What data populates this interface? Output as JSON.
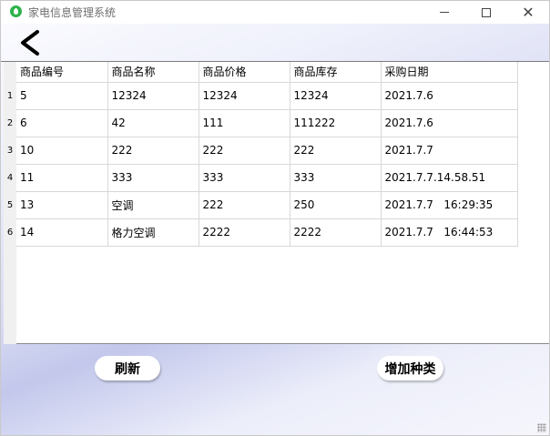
{
  "window": {
    "title": "家电信息管理系统",
    "controls": {
      "minimize": "—",
      "maximize": "☐",
      "close": "✕"
    }
  },
  "toolbar": {
    "back_icon": "chevron-left-icon"
  },
  "table": {
    "columns": [
      "商品编号",
      "商品名称",
      "商品价格",
      "商品库存",
      "采购日期"
    ],
    "row_numbers": [
      "1",
      "2",
      "3",
      "4",
      "5",
      "6"
    ],
    "rows": [
      [
        "5",
        "12324",
        "12324",
        "12324",
        "2021.7.6"
      ],
      [
        "6",
        "42",
        "111",
        "111222",
        "2021.7.6"
      ],
      [
        "10",
        "222",
        "222",
        "222",
        "2021.7.7"
      ],
      [
        "11",
        "333",
        "333",
        "333",
        "2021.7.7.14.58.51"
      ],
      [
        "13",
        "空调",
        "222",
        "250",
        "2021.7.7   16:29:35"
      ],
      [
        "14",
        "格力空调",
        "2222",
        "2222",
        "2021.7.7   16:44:53"
      ]
    ]
  },
  "buttons": {
    "refresh": "刷新",
    "add_category": "增加种类"
  }
}
